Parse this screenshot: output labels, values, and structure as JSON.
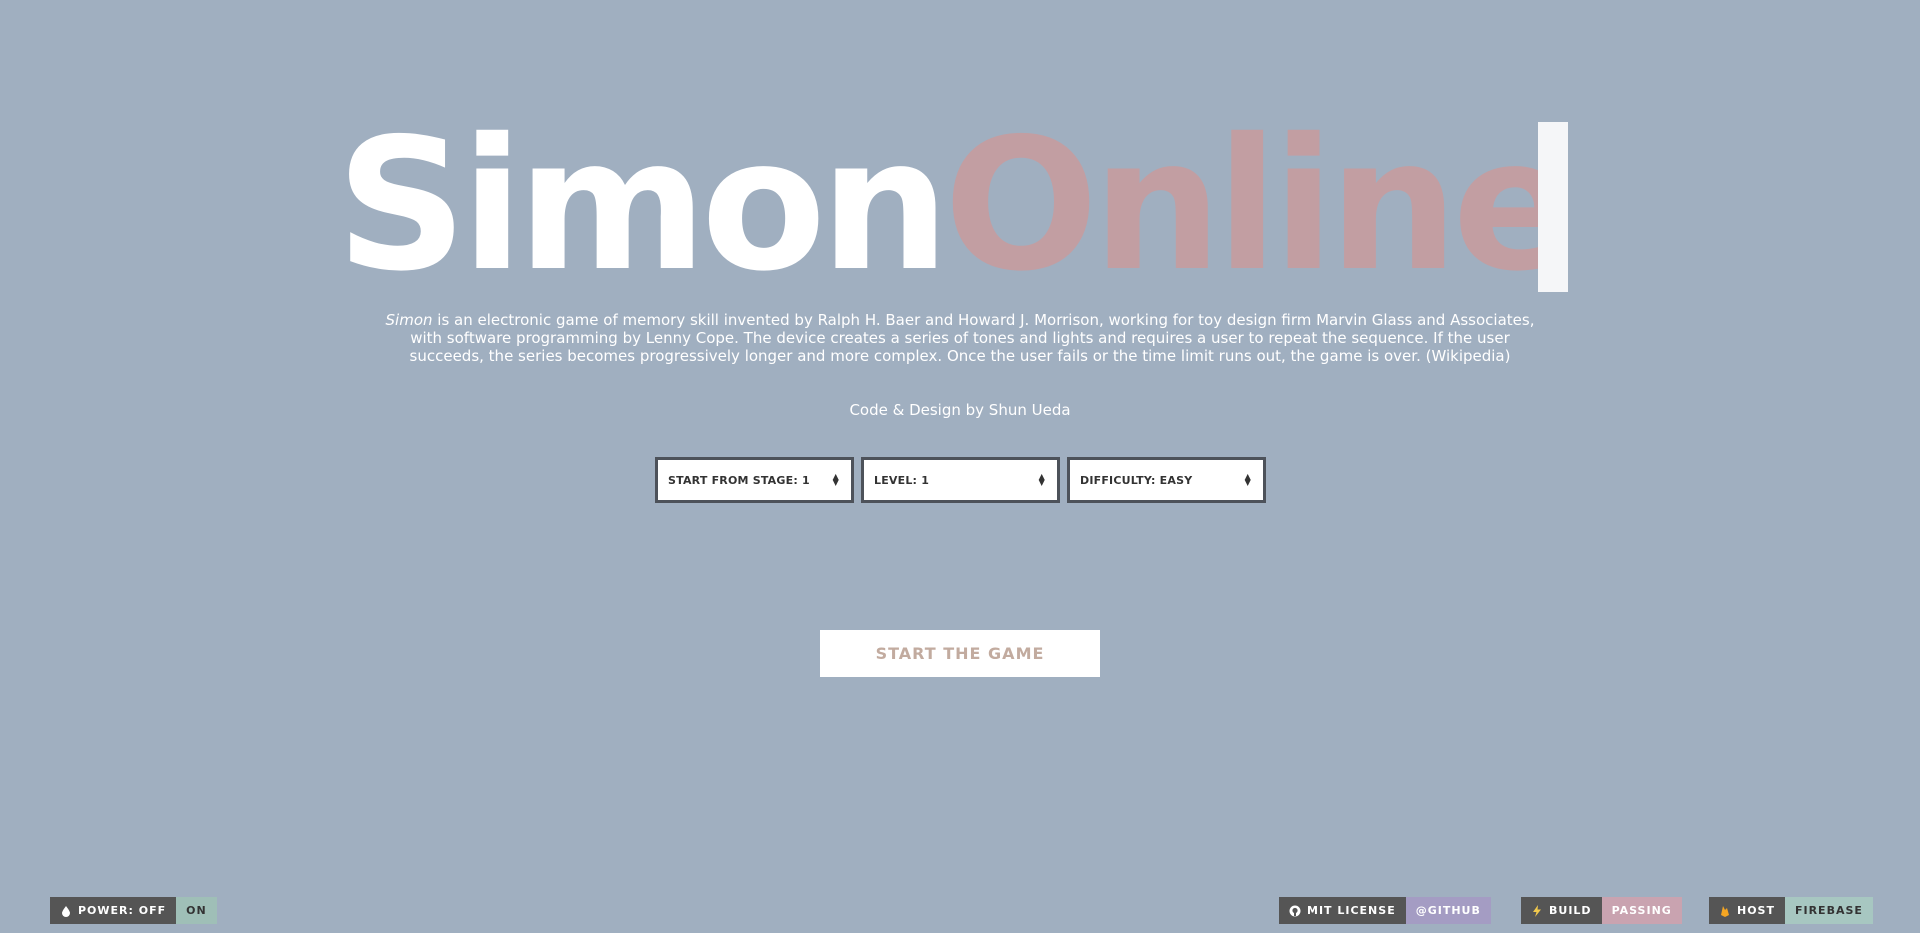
{
  "title": {
    "part1": "Simon",
    "part2": "Online"
  },
  "description": {
    "emphasis": "Simon",
    "text": " is an electronic game of memory skill invented by Ralph H. Baer and Howard J. Morrison, working for toy design firm Marvin Glass and Associates, with software programming by Lenny Cope. The device creates a series of tones and lights and requires a user to repeat the sequence. If the user succeeds, the series becomes progressively longer and more complex. Once the user fails or the time limit runs out, the game is over. (Wikipedia)"
  },
  "credit": "Code & Design by Shun Ueda",
  "selects": {
    "stage": "START FROM STAGE: 1",
    "level": "LEVEL: 1",
    "difficulty": "DIFFICULTY: EASY"
  },
  "start_button": "START THE GAME",
  "badges": {
    "power": {
      "label": "POWER: OFF",
      "value": "ON",
      "icon": "droplet-icon",
      "value_color": "#9fbfb7"
    },
    "license": {
      "label": "MIT LICENSE",
      "value": "@GITHUB",
      "icon": "github-icon",
      "value_color": "#a49cc3"
    },
    "build": {
      "label": "BUILD",
      "value": "PASSING",
      "icon": "lightning-icon",
      "value_color": "#c9a3b0"
    },
    "host": {
      "label": "HOST",
      "value": "FIREBASE",
      "icon": "firebase-icon",
      "value_color": "#a7c7c1"
    }
  },
  "colors": {
    "background": "#a0afc0",
    "title_primary": "#ffffff",
    "title_accent": "#c29ea2",
    "button_text": "#c2ab9f"
  }
}
